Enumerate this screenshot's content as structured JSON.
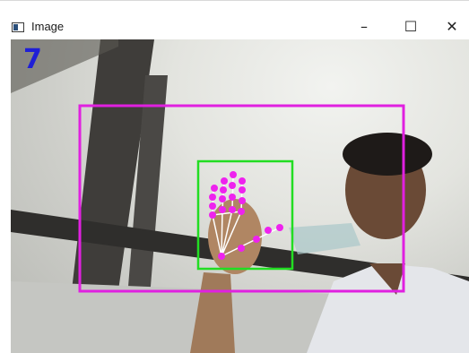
{
  "window": {
    "title": "Image",
    "controls": {
      "minimize": "–",
      "maximize": "☐",
      "close": "✕"
    }
  },
  "frame": {
    "finger_count": "7",
    "box_colors": {
      "body_box": "#e020e0",
      "hand_box": "#22dd22",
      "landmark": "#ee22ee",
      "connector": "#ffffff",
      "counter": "#1f1fd6"
    }
  }
}
